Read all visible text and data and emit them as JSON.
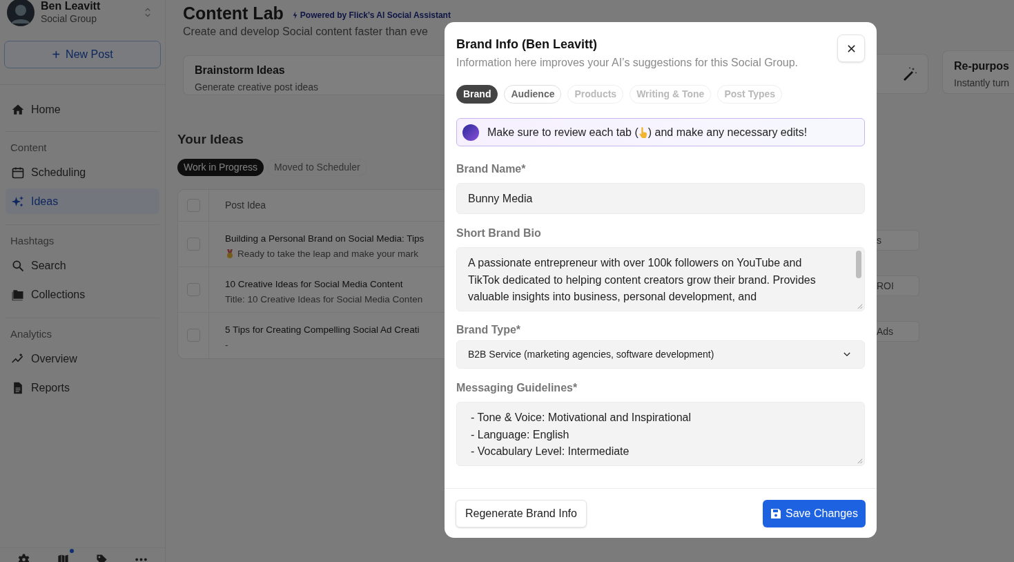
{
  "sidebar": {
    "user": {
      "name": "Ben Leavitt",
      "group": "Social Group"
    },
    "new_post": {
      "icon": "+",
      "label": "New Post"
    },
    "sections": [
      {
        "items": [
          {
            "kind": "home",
            "label": "Home",
            "selected": false
          }
        ]
      },
      {
        "title": "Content",
        "items": [
          {
            "kind": "calendar",
            "label": "Scheduling",
            "selected": false
          },
          {
            "kind": "sparkle",
            "label": "Ideas",
            "selected": true
          }
        ]
      },
      {
        "title": "Hashtags",
        "items": [
          {
            "kind": "search",
            "label": "Search",
            "selected": false
          },
          {
            "kind": "folder",
            "label": "Collections",
            "selected": false
          }
        ]
      },
      {
        "title": "Analytics",
        "items": [
          {
            "kind": "trend",
            "label": "Overview",
            "selected": false
          },
          {
            "kind": "document",
            "label": "Reports",
            "selected": false
          }
        ]
      }
    ],
    "footer_icons": [
      {
        "kind": "settings",
        "badge": false
      },
      {
        "kind": "map",
        "badge": true
      },
      {
        "kind": "tag",
        "badge": false
      },
      {
        "kind": "more",
        "badge": false
      }
    ]
  },
  "main": {
    "title": "Content Lab",
    "powered_by": "Powered by Flick’s AI Social Assistant",
    "subtitle": "Create and develop Social content faster than eve",
    "cards": [
      {
        "kind": "text",
        "title": "Brainstorm Ideas",
        "description": "Generate creative post ideas"
      }
    ],
    "right_cards": [
      {
        "kind": "wand"
      },
      {
        "kind": "text",
        "title": "Re-purpos",
        "description": "Instantly turn"
      }
    ],
    "ideas": {
      "title": "Your Ideas",
      "tabs": [
        {
          "label": "Work in Progress",
          "selected": true
        },
        {
          "label": "Moved to Scheduler",
          "selected": false
        }
      ],
      "table": {
        "select_all_checked": false,
        "columns": [
          "Post Idea"
        ],
        "rows": [
          {
            "checked": false,
            "title": "Building a Personal Brand on Social Media: Tips",
            "medal": true,
            "preview": "Ready to take the leap and make your mark",
            "tag": "s"
          },
          {
            "checked": false,
            "title": "10 Creative Ideas for Social Media Content",
            "medal": false,
            "preview": "Title: 10 Creative Ideas for Social Media Conten",
            "tag": "ROI"
          },
          {
            "checked": false,
            "title": "5 Tips for Creating Compelling Social Ad Creati",
            "medal": false,
            "preview": "-",
            "tag": "Ads"
          }
        ]
      }
    }
  },
  "modal": {
    "title": "Brand Info (Ben Leavitt)",
    "subtitle": "Information here improves your AI’s suggestions for this Social Group.",
    "tabs": [
      {
        "label": "Brand",
        "selected": true,
        "disabled": false
      },
      {
        "label": "Audience",
        "selected": false,
        "disabled": false
      },
      {
        "label": "Products",
        "selected": false,
        "disabled": true
      },
      {
        "label": "Writing & Tone",
        "selected": false,
        "disabled": true
      },
      {
        "label": "Post Types",
        "selected": false,
        "disabled": true
      }
    ],
    "notice": {
      "before": "Make sure to review each tab (",
      "after": ") and make any necessary edits!"
    },
    "fields": [
      {
        "kind": "input",
        "label": "Brand Name*",
        "value": "Bunny Media"
      },
      {
        "kind": "textarea",
        "label": "Short Brand Bio",
        "value": "A passionate entrepreneur with over 100k followers on YouTube and TikTok dedicated to helping content creators grow their brand. Provides valuable insights into business, personal development, and",
        "scrollable": true
      },
      {
        "kind": "select",
        "label": "Brand Type*",
        "value": "B2B Service (marketing agencies, software development)"
      },
      {
        "kind": "textarea",
        "label": "Messaging Guidelines*",
        "value": "- Tone & Voice: Motivational and Inspirational\n- Language: English\n- Vocabulary Level: Intermediate",
        "scrollable": false
      }
    ],
    "buttons": [
      {
        "kind": "secondary",
        "label": "Regenerate Brand Info"
      },
      {
        "kind": "primary",
        "label": "Save Changes"
      }
    ]
  }
}
